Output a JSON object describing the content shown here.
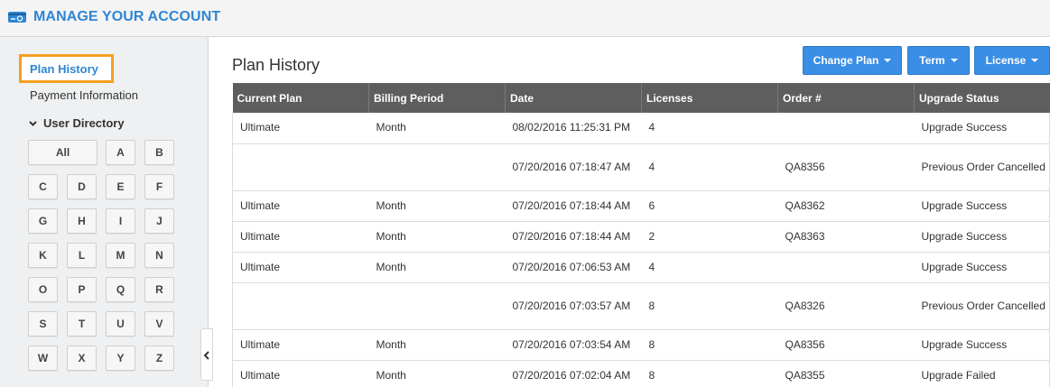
{
  "header": {
    "title": "MANAGE YOUR ACCOUNT",
    "logo_icon": "credit-card-refresh-icon"
  },
  "sidebar": {
    "active_item": "Plan History",
    "items": [
      "Payment Information"
    ],
    "directory_label": "User Directory",
    "directory_icon": "chevron-down-icon",
    "letters": [
      "All",
      "A",
      "B",
      "C",
      "D",
      "E",
      "F",
      "G",
      "H",
      "I",
      "J",
      "K",
      "L",
      "M",
      "N",
      "O",
      "P",
      "Q",
      "R",
      "S",
      "T",
      "U",
      "V",
      "W",
      "X",
      "Y",
      "Z"
    ],
    "collapse_icon": "chevron-left-icon"
  },
  "main": {
    "title": "Plan History",
    "buttons": {
      "change_plan": "Change Plan",
      "term": "Term",
      "license": "License"
    },
    "accent_color": "#3b8ee5"
  },
  "table": {
    "headers": [
      "Current Plan",
      "Billing Period",
      "Date",
      "Licenses",
      "Order #",
      "Upgrade Status"
    ],
    "rows": [
      [
        "Ultimate",
        "Month",
        "08/02/2016 11:25:31 PM",
        "4",
        "",
        "Upgrade Success"
      ],
      [
        "",
        "",
        "07/20/2016 07:18:47 AM",
        "4",
        "QA8356",
        "Previous Order Cancelled"
      ],
      [
        "Ultimate",
        "Month",
        "07/20/2016 07:18:44 AM",
        "6",
        "QA8362",
        "Upgrade Success"
      ],
      [
        "Ultimate",
        "Month",
        "07/20/2016 07:18:44 AM",
        "2",
        "QA8363",
        "Upgrade Success"
      ],
      [
        "Ultimate",
        "Month",
        "07/20/2016 07:06:53 AM",
        "4",
        "",
        "Upgrade Success"
      ],
      [
        "",
        "",
        "07/20/2016 07:03:57 AM",
        "8",
        "QA8326",
        "Previous Order Cancelled"
      ],
      [
        "Ultimate",
        "Month",
        "07/20/2016 07:03:54 AM",
        "8",
        "QA8356",
        "Upgrade Success"
      ],
      [
        "Ultimate",
        "Month",
        "07/20/2016 07:02:04 AM",
        "8",
        "QA8355",
        "Upgrade Failed"
      ]
    ]
  }
}
